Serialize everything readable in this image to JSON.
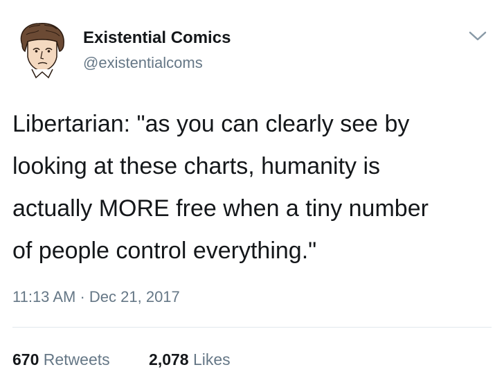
{
  "author": {
    "display_name": "Existential Comics",
    "handle": "@existentialcoms",
    "avatar_icon": "cartoon-portrait-avatar"
  },
  "menu_icon": "chevron-down-icon",
  "tweet": {
    "lines": [
      "Libertarian: \"as you can clearly see by",
      "looking at these charts, humanity is",
      "actually MORE free when a tiny number",
      "of people control everything.\""
    ],
    "time": "11:13 AM",
    "separator": "·",
    "date": "Dec 21, 2017"
  },
  "stats": {
    "retweets_count": "670",
    "retweets_label": "Retweets",
    "likes_count": "2,078",
    "likes_label": "Likes"
  },
  "colors": {
    "text": "#14171a",
    "secondary_text": "#657786",
    "divider": "#e1e8ed"
  }
}
